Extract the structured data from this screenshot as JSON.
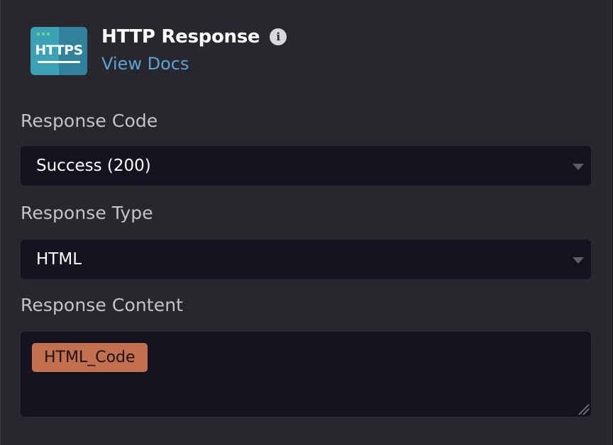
{
  "header": {
    "app_icon_text": "HTTPS",
    "title": "HTTP Response",
    "docs_link": "View Docs"
  },
  "response_code": {
    "label": "Response Code",
    "selected": "Success (200)"
  },
  "response_type": {
    "label": "Response Type",
    "selected": "HTML"
  },
  "response_content": {
    "label": "Response Content",
    "token": "HTML_Code"
  },
  "colors": {
    "panel_bg": "#28272d",
    "field_bg": "#151320",
    "link": "#5ba4d8",
    "token_bg": "#c2704d",
    "icon_teal": "#3aa2b4"
  }
}
